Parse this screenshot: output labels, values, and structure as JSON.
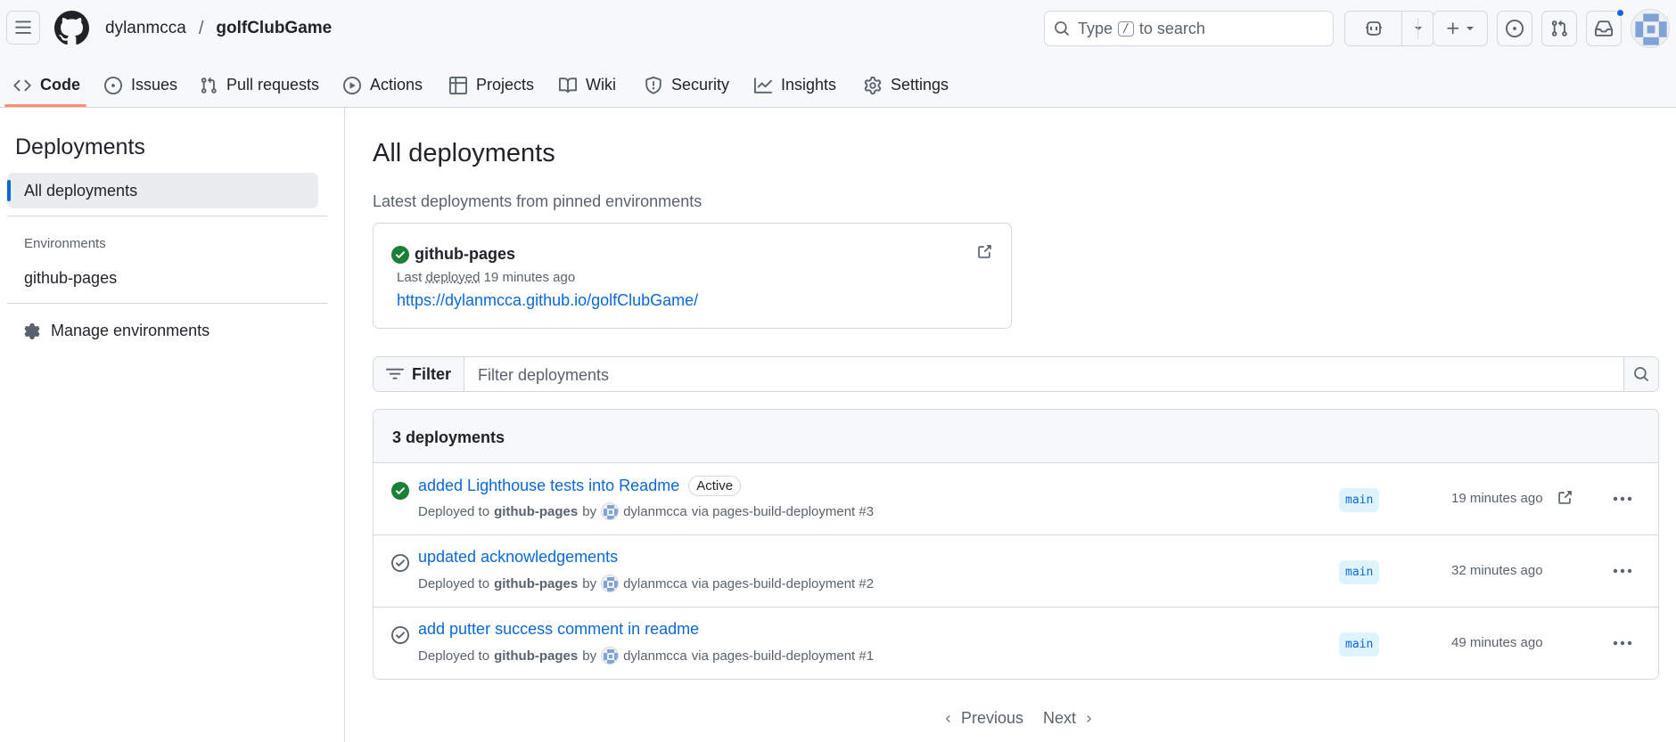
{
  "header": {
    "owner": "dylanmcca",
    "separator": "/",
    "repo": "golfClubGame",
    "search_prefix": "Type",
    "search_key": "/",
    "search_suffix": "to search"
  },
  "tabs": [
    {
      "label": "Code",
      "icon": "code-icon",
      "selected": true
    },
    {
      "label": "Issues",
      "icon": "issue-opened-icon"
    },
    {
      "label": "Pull requests",
      "icon": "git-pull-request-icon"
    },
    {
      "label": "Actions",
      "icon": "play-icon"
    },
    {
      "label": "Projects",
      "icon": "table-icon"
    },
    {
      "label": "Wiki",
      "icon": "book-icon"
    },
    {
      "label": "Security",
      "icon": "shield-icon"
    },
    {
      "label": "Insights",
      "icon": "graph-icon"
    },
    {
      "label": "Settings",
      "icon": "gear-icon"
    }
  ],
  "sidebar": {
    "title": "Deployments",
    "active_item": "All deployments",
    "environments_heading": "Environments",
    "environments": [
      "github-pages"
    ],
    "manage": "Manage environments"
  },
  "main": {
    "title": "All deployments",
    "subtitle": "Latest deployments from pinned environments",
    "pinned": {
      "name": "github-pages",
      "meta_prefix": "Last",
      "meta_link": "deployed",
      "meta_time": "19 minutes ago",
      "url": "https://dylanmcca.github.io/golfClubGame/"
    },
    "filter": {
      "button": "Filter",
      "placeholder": "Filter deployments"
    },
    "deployments_count": "3 deployments",
    "deployments": [
      {
        "title": "added Lighthouse tests into Readme",
        "badge": "Active",
        "deployed_to": "Deployed to",
        "env": "github-pages",
        "by": "by",
        "user": "dylanmcca",
        "via": "via pages-build-deployment #3",
        "branch": "main",
        "time": "19 minutes ago",
        "status": "success"
      },
      {
        "title": "updated acknowledgements",
        "badge": "",
        "deployed_to": "Deployed to",
        "env": "github-pages",
        "by": "by",
        "user": "dylanmcca",
        "via": "via pages-build-deployment #2",
        "branch": "main",
        "time": "32 minutes ago",
        "status": "inactive"
      },
      {
        "title": "add putter success comment in readme",
        "badge": "",
        "deployed_to": "Deployed to",
        "env": "github-pages",
        "by": "by",
        "user": "dylanmcca",
        "via": "via pages-build-deployment #1",
        "branch": "main",
        "time": "49 minutes ago",
        "status": "inactive"
      }
    ],
    "pagination": {
      "previous": "Previous",
      "next": "Next"
    }
  },
  "colors": {
    "accent": "#0969da",
    "success": "#1a7f37",
    "tab_underline": "#fd8c73",
    "branch_bg": "#ddf4ff"
  }
}
